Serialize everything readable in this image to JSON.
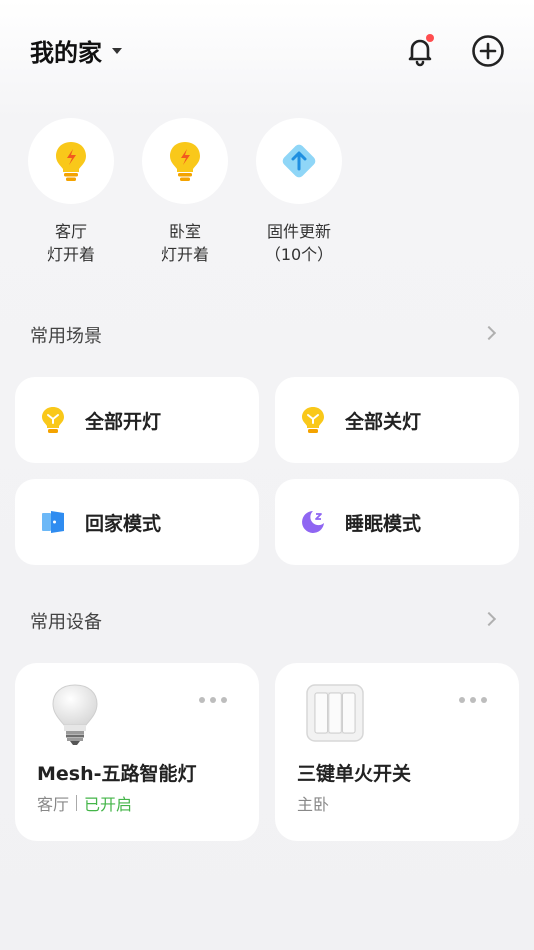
{
  "header": {
    "home_name": "我的家"
  },
  "quick_status": [
    {
      "label_line1": "客厅",
      "label_line2": "灯开着",
      "icon": "light-bulb-icon"
    },
    {
      "label_line1": "卧室",
      "label_line2": "灯开着",
      "icon": "light-bulb-icon"
    },
    {
      "label_line1": "固件更新",
      "label_line2": "（10个）",
      "icon": "firmware-update-icon"
    }
  ],
  "scenes_section": {
    "title": "常用场景",
    "items": [
      {
        "label": "全部开灯",
        "icon": "bulb-on-icon",
        "color": "#f5b800"
      },
      {
        "label": "全部关灯",
        "icon": "bulb-off-icon",
        "color": "#f5b800"
      },
      {
        "label": "回家模式",
        "icon": "door-icon",
        "color": "#2f8cf0"
      },
      {
        "label": "睡眠模式",
        "icon": "moon-icon",
        "color": "#8f66f2"
      }
    ]
  },
  "devices_section": {
    "title": "常用设备",
    "items": [
      {
        "name": "Mesh-五路智能灯",
        "room": "客厅",
        "status": "已开启",
        "icon": "smart-bulb-icon"
      },
      {
        "name": "三键单火开关",
        "room": "主卧",
        "status": "",
        "icon": "triple-switch-icon"
      }
    ]
  },
  "colors": {
    "accent_on": "#44b549",
    "notification_dot": "#ff4d4f",
    "bulb_yellow": "#f9c81a"
  }
}
